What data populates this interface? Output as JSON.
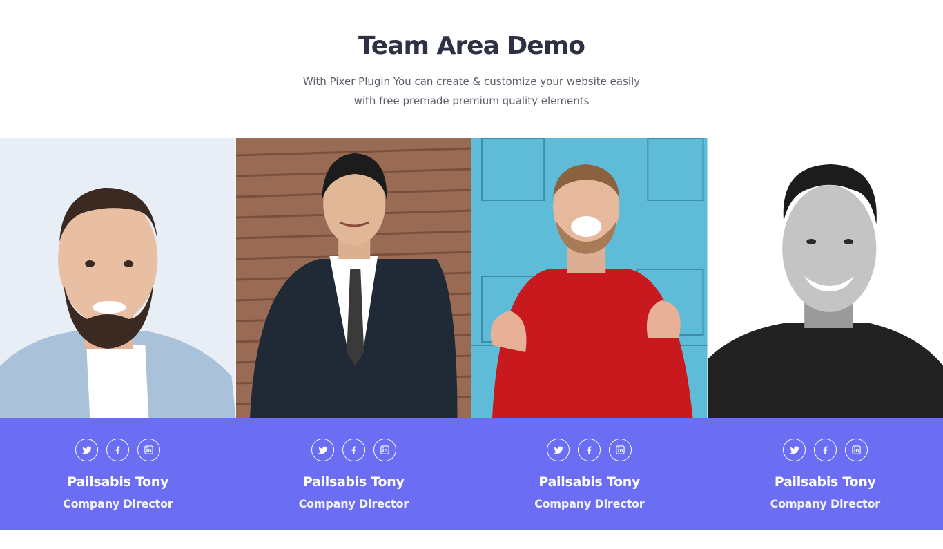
{
  "header": {
    "title": "Team Area Demo",
    "subtitle_line1": "With Pixer Plugin You can create & customize your website easily",
    "subtitle_line2": "with free premade premium quality elements"
  },
  "colors": {
    "accent": "#6b6ef3",
    "title": "#2d3143",
    "text": "#5c5f6a"
  },
  "team": [
    {
      "name": "Pailsabis Tony",
      "role": "Company Director",
      "photo": "man-bearded-light-blue-shirt",
      "socials": [
        "twitter-icon",
        "facebook-icon",
        "linkedin-icon"
      ]
    },
    {
      "name": "Pailsabis Tony",
      "role": "Company Director",
      "photo": "man-in-dark-suit-wood-wall",
      "socials": [
        "twitter-icon",
        "facebook-icon",
        "linkedin-icon"
      ]
    },
    {
      "name": "Pailsabis Tony",
      "role": "Company Director",
      "photo": "laughing-man-red-sweater-blue-wall",
      "socials": [
        "twitter-icon",
        "facebook-icon",
        "linkedin-icon"
      ]
    },
    {
      "name": "Pailsabis Tony",
      "role": "Company Director",
      "photo": "smiling-man-black-and-white",
      "socials": [
        "twitter-icon",
        "facebook-icon",
        "linkedin-icon"
      ]
    }
  ]
}
